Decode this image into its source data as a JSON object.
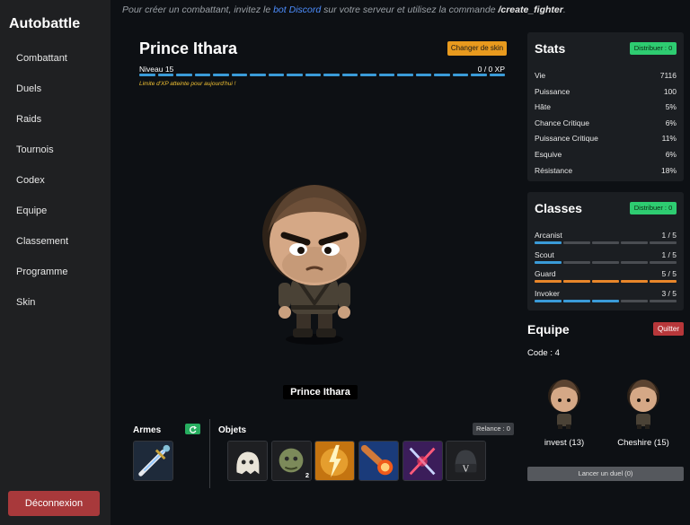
{
  "sidebar": {
    "brand": "Autobattle",
    "items": [
      "Combattant",
      "Duels",
      "Raids",
      "Tournois",
      "Codex",
      "Equipe",
      "Classement",
      "Programme",
      "Skin"
    ],
    "logout": "Déconnexion"
  },
  "info": {
    "prefix": "Pour créer un combattant, invitez le ",
    "link": "bot Discord",
    "middle": " sur votre serveur et utilisez la commande ",
    "command": "/create_fighter",
    "suffix": "."
  },
  "fighter": {
    "name": "Prince Ithara",
    "skin_button": "Changer de skin",
    "level": "Niveau 15",
    "xp": "0 / 0 XP",
    "xp_limit": "Limite d'XP atteinte pour aujourd'hui !",
    "label": "Prince Ithara"
  },
  "weapons": {
    "title": "Armes",
    "refresh_icon": "refresh-icon"
  },
  "objects": {
    "title": "Objets",
    "reroll": "Relance : 0",
    "stack_count": "2"
  },
  "stats": {
    "title": "Stats",
    "distribute": "Distribuer : 0",
    "rows": [
      {
        "label": "Vie",
        "value": "7116"
      },
      {
        "label": "Puissance",
        "value": "100"
      },
      {
        "label": "Hâte",
        "value": "5%"
      },
      {
        "label": "Chance Critique",
        "value": "6%"
      },
      {
        "label": "Puissance Critique",
        "value": "11%"
      },
      {
        "label": "Esquive",
        "value": "6%"
      },
      {
        "label": "Résistance",
        "value": "18%"
      }
    ]
  },
  "classes": {
    "title": "Classes",
    "distribute": "Distribuer : 0",
    "rows": [
      {
        "label": "Arcanist",
        "value": "1 / 5",
        "level": 1,
        "color": "#3a9bd8"
      },
      {
        "label": "Scout",
        "value": "1 / 5",
        "level": 1,
        "color": "#3a9bd8"
      },
      {
        "label": "Guard",
        "value": "5 / 5",
        "level": 5,
        "color": "#e8862a"
      },
      {
        "label": "Invoker",
        "value": "3 / 5",
        "level": 3,
        "color": "#3a9bd8"
      }
    ]
  },
  "team": {
    "title": "Equipe",
    "quit": "Quitter",
    "code": "Code : 4",
    "members": [
      {
        "name": "invest (13)"
      },
      {
        "name": "Cheshire (15)"
      }
    ],
    "duel_button": "Lancer un duel (0)"
  },
  "colors": {
    "accent_orange": "#e89a1e",
    "accent_green": "#2ecc71",
    "danger": "#a8393b",
    "xp_blue": "#3a9bd8"
  }
}
